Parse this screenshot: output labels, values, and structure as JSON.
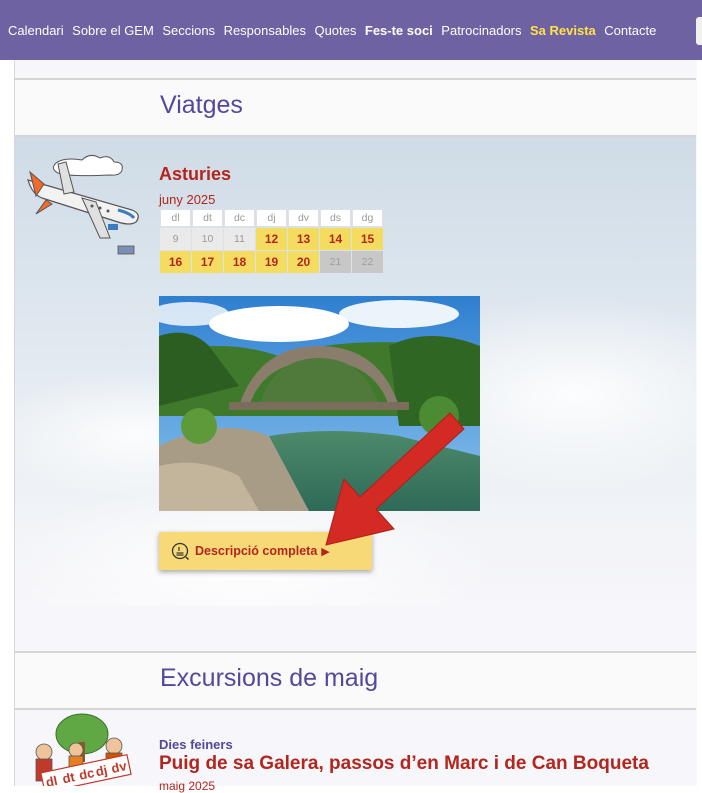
{
  "nav": {
    "items": [
      {
        "label": "Calendari"
      },
      {
        "label": "Sobre el GEM"
      },
      {
        "label": "Seccions"
      },
      {
        "label": "Responsables"
      },
      {
        "label": "Quotes"
      },
      {
        "label": "Fes-te soci"
      },
      {
        "label": "Patrocinadors"
      },
      {
        "label": "Sa Revista"
      },
      {
        "label": "Contacte"
      }
    ]
  },
  "viatges": {
    "section_title": "Viatges",
    "trip": {
      "title": "Asturies",
      "month": "juny 2025",
      "calendar": {
        "headers": [
          "dl",
          "dt",
          "dc",
          "dj",
          "dv",
          "ds",
          "dg"
        ],
        "rows": [
          [
            "9",
            "10",
            "11",
            "12",
            "13",
            "14",
            "15"
          ],
          [
            "16",
            "17",
            "18",
            "19",
            "20",
            "21",
            "22"
          ]
        ]
      },
      "button_label": "Descripció completa",
      "button_icon": "document-icon"
    }
  },
  "excursions": {
    "section_title": "Excursions de maig",
    "badge_letters": [
      "dl",
      "dt",
      "dc",
      "dj",
      "dv"
    ],
    "item": {
      "subtitle": "Dies feiners",
      "title": "Puig de sa Galera, passos d’en Marc i de Can Boqueta",
      "date": "maig 2025"
    }
  },
  "colors": {
    "nav_bg": "#6f62a2",
    "section_title": "#55489a",
    "accent_red": "#b3261e",
    "highlight_yellow": "#f3dc5f",
    "nav_yellow": "#ffe14a"
  }
}
